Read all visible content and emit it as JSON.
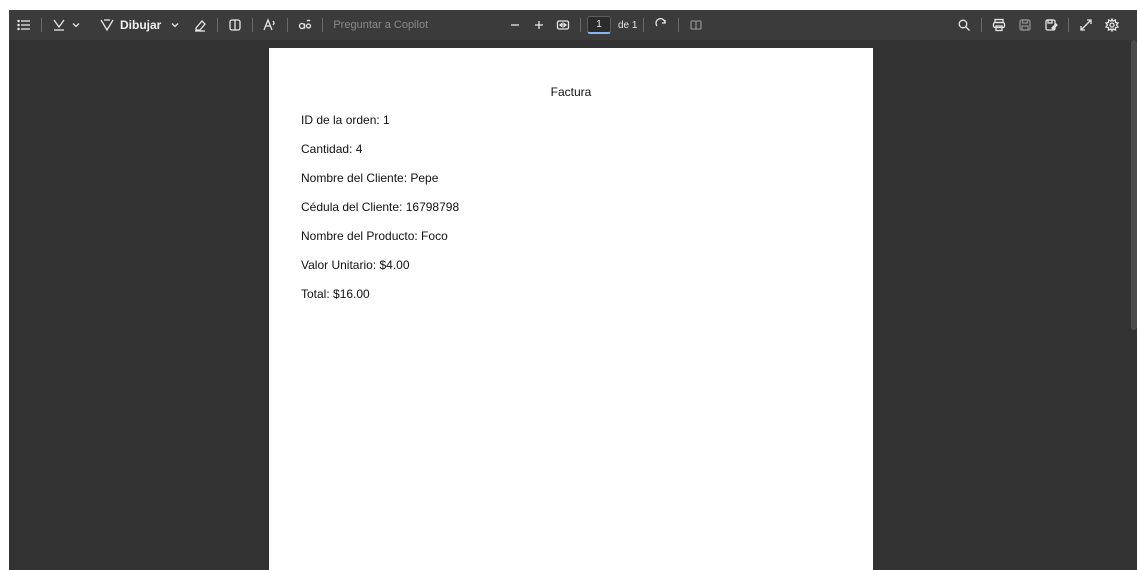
{
  "toolbar": {
    "icons": {
      "contents": "table-of-contents-icon",
      "highlight": "highlighter-icon",
      "draw": "pen-icon",
      "erase": "eraser-icon",
      "textbox": "text-box-icon",
      "read_aloud": "read-aloud-icon",
      "translate": "translate-icon",
      "zoom_out": "minus-icon",
      "zoom_in": "plus-icon",
      "fit": "fit-page-icon",
      "rotate": "rotate-icon",
      "page_view": "page-view-icon",
      "search": "search-icon",
      "print": "print-icon",
      "save": "save-icon",
      "save_as": "save-as-icon",
      "expand": "expand-icon",
      "settings": "gear-icon"
    },
    "draw_label": "Dibujar",
    "copilot_placeholder": "Preguntar a Copilot",
    "page_current": "1",
    "page_total": "de 1"
  },
  "document": {
    "title": "Factura",
    "lines": [
      "ID de la orden: 1",
      "Cantidad: 4",
      "Nombre del Cliente: Pepe",
      "Cédula del Cliente: 16798798",
      "Nombre del Producto: Foco",
      "Valor Unitario: $4.00",
      "Total: $16.00"
    ]
  },
  "colors": {
    "toolbar_bg": "#3b3b3b",
    "viewer_bg": "#323233",
    "page_bg": "#ffffff",
    "accent": "#8ab4f8"
  }
}
